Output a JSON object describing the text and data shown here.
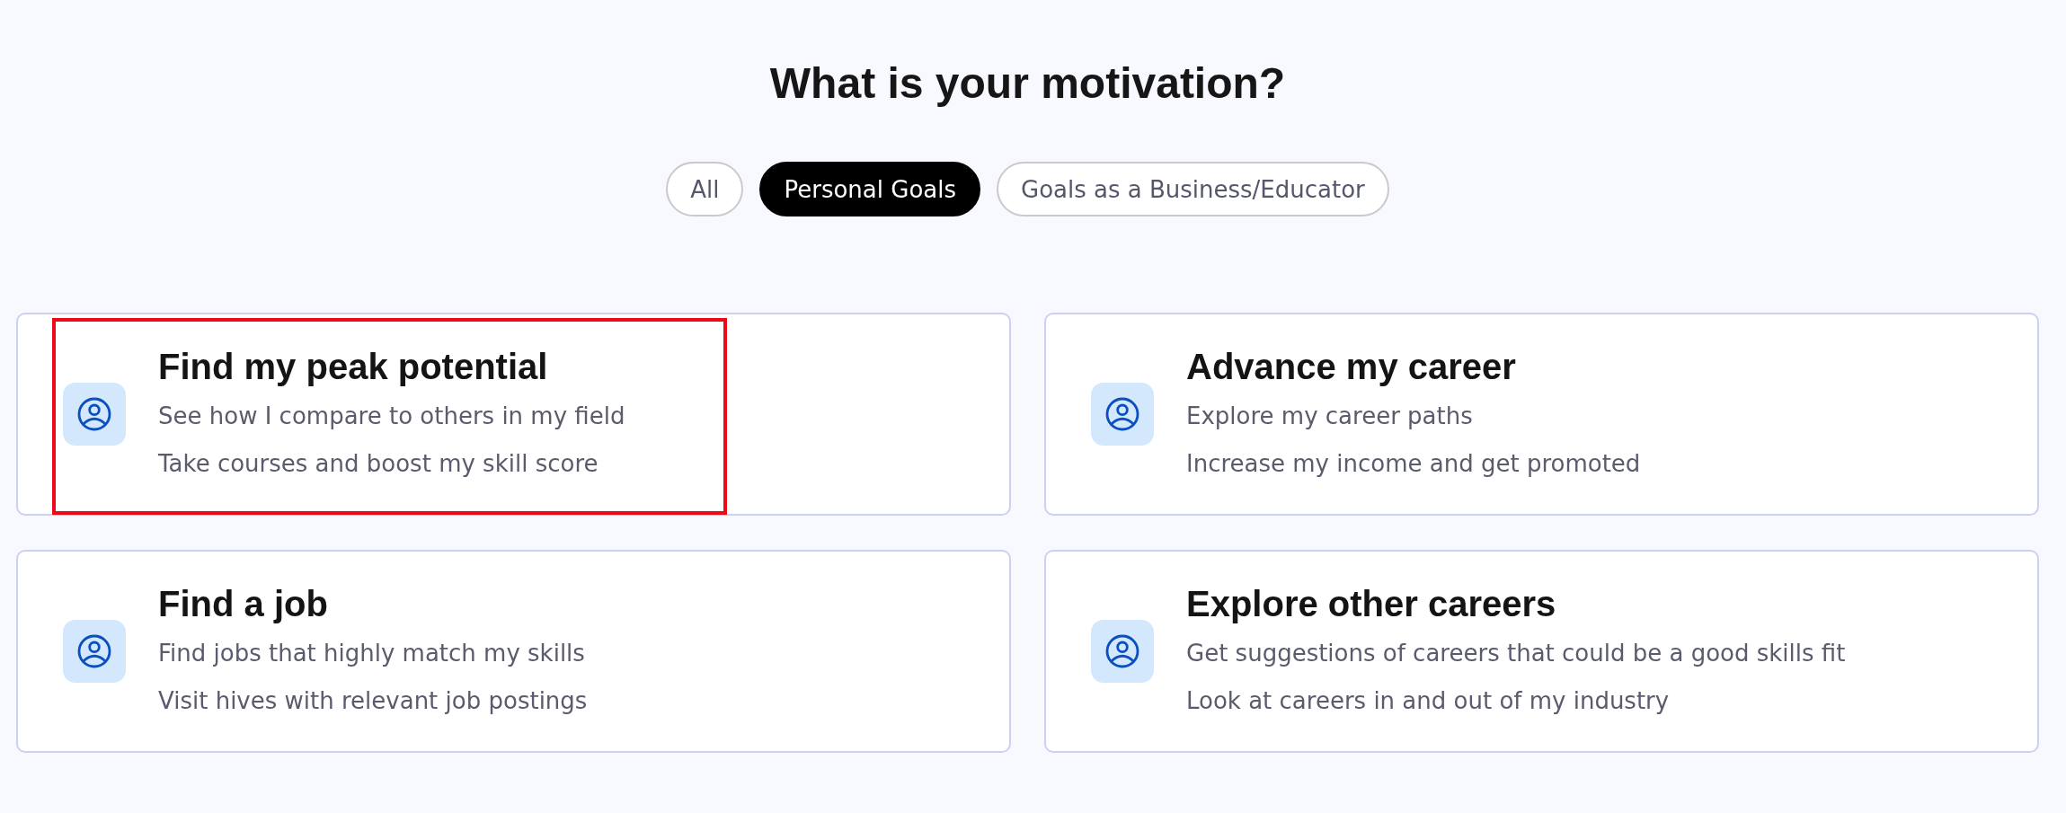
{
  "heading": "What is your motivation?",
  "tabs": [
    {
      "label": "All",
      "selected": false
    },
    {
      "label": "Personal Goals",
      "selected": true
    },
    {
      "label": "Goals as a Business/Educator",
      "selected": false
    }
  ],
  "cards": [
    {
      "title": "Find my peak potential",
      "lines": [
        "See how I compare to others in my field",
        "Take courses and boost my skill score"
      ],
      "highlighted": true
    },
    {
      "title": "Advance my career",
      "lines": [
        "Explore my career paths",
        "Increase my income and get promoted"
      ],
      "highlighted": false
    },
    {
      "title": "Find a job",
      "lines": [
        "Find jobs that highly match my skills",
        "Visit hives with relevant job postings"
      ],
      "highlighted": false
    },
    {
      "title": "Explore other careers",
      "lines": [
        "Get suggestions of careers that could be a good skills fit",
        "Look at careers in and out of my industry"
      ],
      "highlighted": false
    }
  ]
}
